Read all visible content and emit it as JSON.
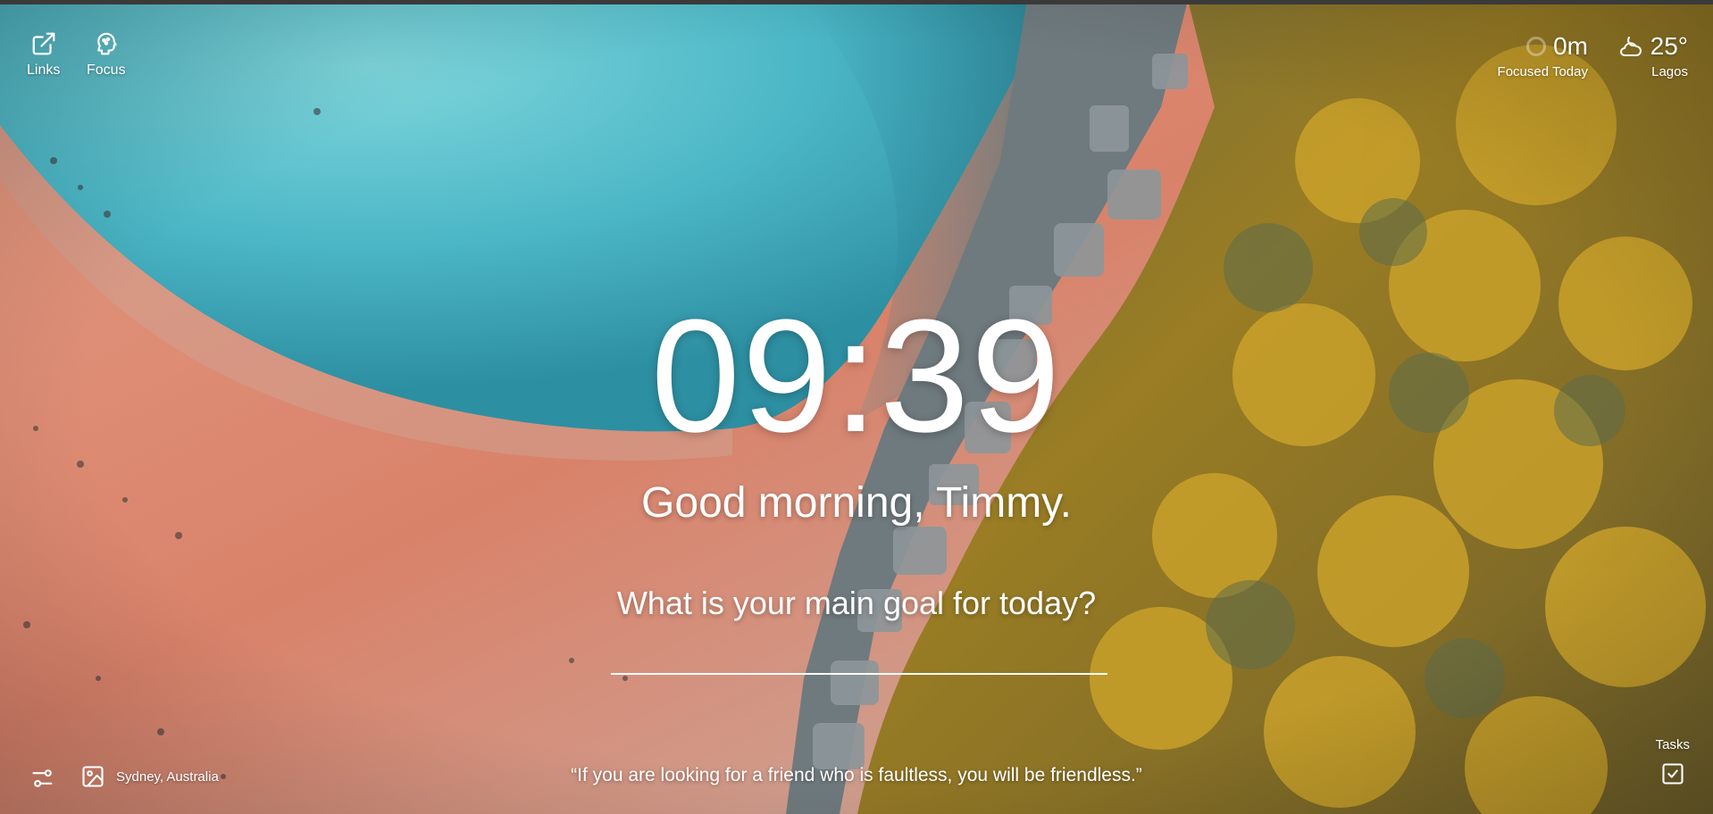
{
  "nav": {
    "links_label": "Links",
    "focus_label": "Focus"
  },
  "focus_stat": {
    "value": "0m",
    "caption": "Focused Today"
  },
  "weather": {
    "temperature": "25°",
    "location": "Lagos",
    "icon": "partly-cloudy-night-icon"
  },
  "clock": {
    "time": "09:39"
  },
  "greeting": "Good morning, Timmy.",
  "goal": {
    "question": "What is your main goal for today?",
    "value": "",
    "placeholder": ""
  },
  "footer": {
    "photo_location": "Sydney, Australia",
    "quote": "“If you are looking for a friend who is faultless, you will be friendless.”",
    "tasks_label": "Tasks"
  },
  "colors": {
    "text": "#ffffff",
    "water": "#4fc3cf",
    "sand": "#d98b73",
    "foliage": "#b8901e"
  }
}
